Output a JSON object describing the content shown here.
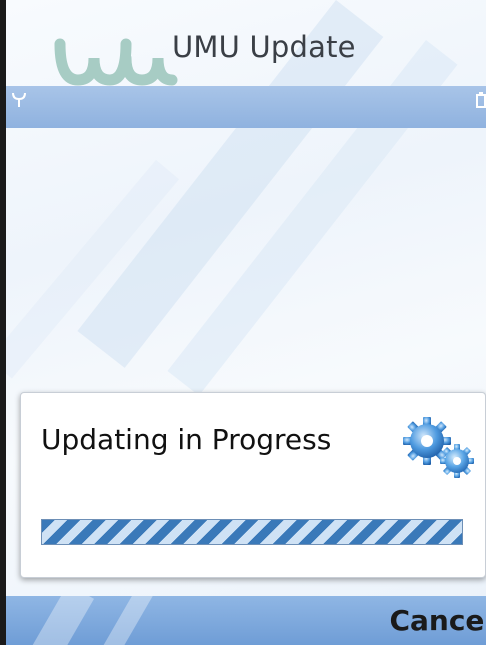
{
  "app": {
    "title": "UMU Update",
    "logo_icon": "umu-logo-icon",
    "logo_color": "#a7ccc4"
  },
  "status_bar": {
    "signal_icon": "signal-antenna-icon",
    "battery_icon": "battery-icon",
    "color": "#9bbbe4"
  },
  "dialog": {
    "message": "Updating in Progress",
    "icon": "gears-icon",
    "progress_fraction": 1.0
  },
  "softkeys": {
    "right_label": "Cancel"
  }
}
